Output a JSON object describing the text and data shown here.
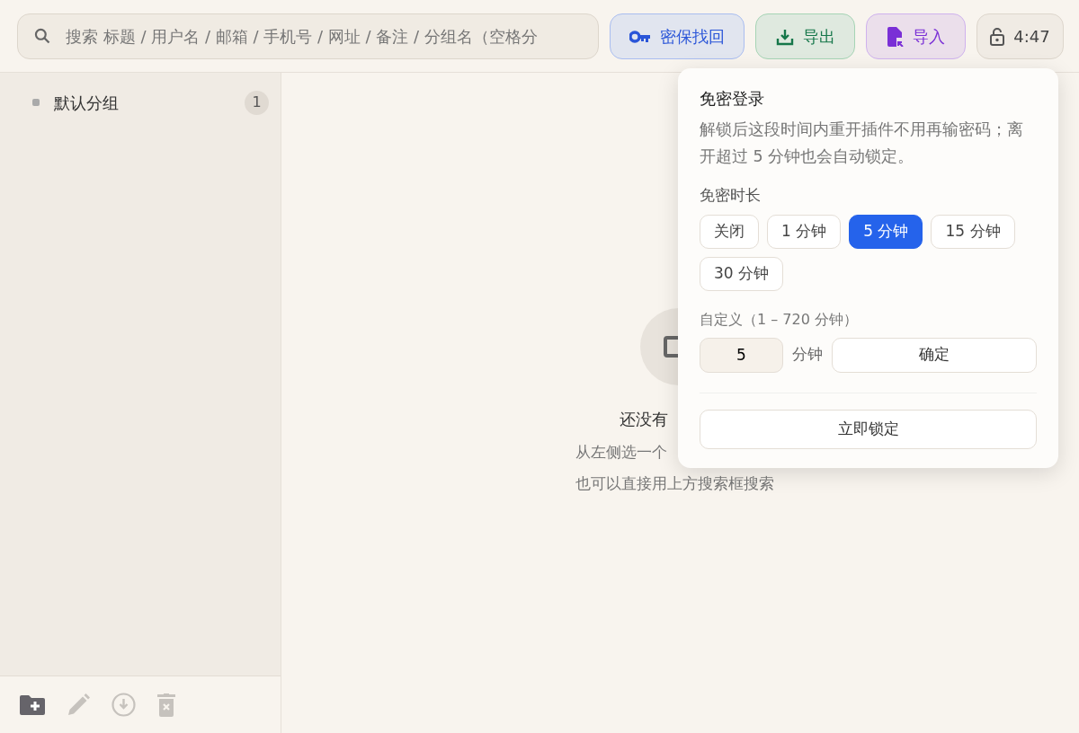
{
  "search": {
    "placeholder": "搜索 标题 / 用户名 / 邮箱 / 手机号 / 网址 / 备注 / 分组名（空格分"
  },
  "toolbar_buttons": [
    {
      "kind": "recover",
      "label": "密保找回"
    },
    {
      "kind": "export",
      "label": "导出"
    },
    {
      "kind": "import",
      "label": "导入"
    },
    {
      "kind": "lock",
      "label": "4:47"
    }
  ],
  "sidebar": {
    "groups": [
      {
        "name": "默认分组",
        "count": "1"
      }
    ],
    "actions": [
      {
        "kind": "new-folder",
        "disabled": false
      },
      {
        "kind": "edit",
        "disabled": true
      },
      {
        "kind": "download",
        "disabled": true
      },
      {
        "kind": "delete",
        "disabled": true
      }
    ]
  },
  "empty_state": {
    "title": "还没有",
    "lines": [
      "从左侧选一个",
      "也可以直接用上方搜索框搜索"
    ]
  },
  "popover": {
    "title": "免密登录",
    "description": "解锁后这段时间内重开插件不用再输密码；离开超过 5 分钟也会自动锁定。",
    "duration_label": "免密时长",
    "options": [
      {
        "label": "关闭",
        "selected": false
      },
      {
        "label": "1 分钟",
        "selected": false
      },
      {
        "label": "5 分钟",
        "selected": true
      },
      {
        "label": "15 分钟",
        "selected": false
      },
      {
        "label": "30 分钟",
        "selected": false
      }
    ],
    "custom_label": "自定义（1 – 720 分钟）",
    "custom_value": "5",
    "unit": "分钟",
    "confirm": "确定",
    "lock_now": "立即锁定"
  }
}
